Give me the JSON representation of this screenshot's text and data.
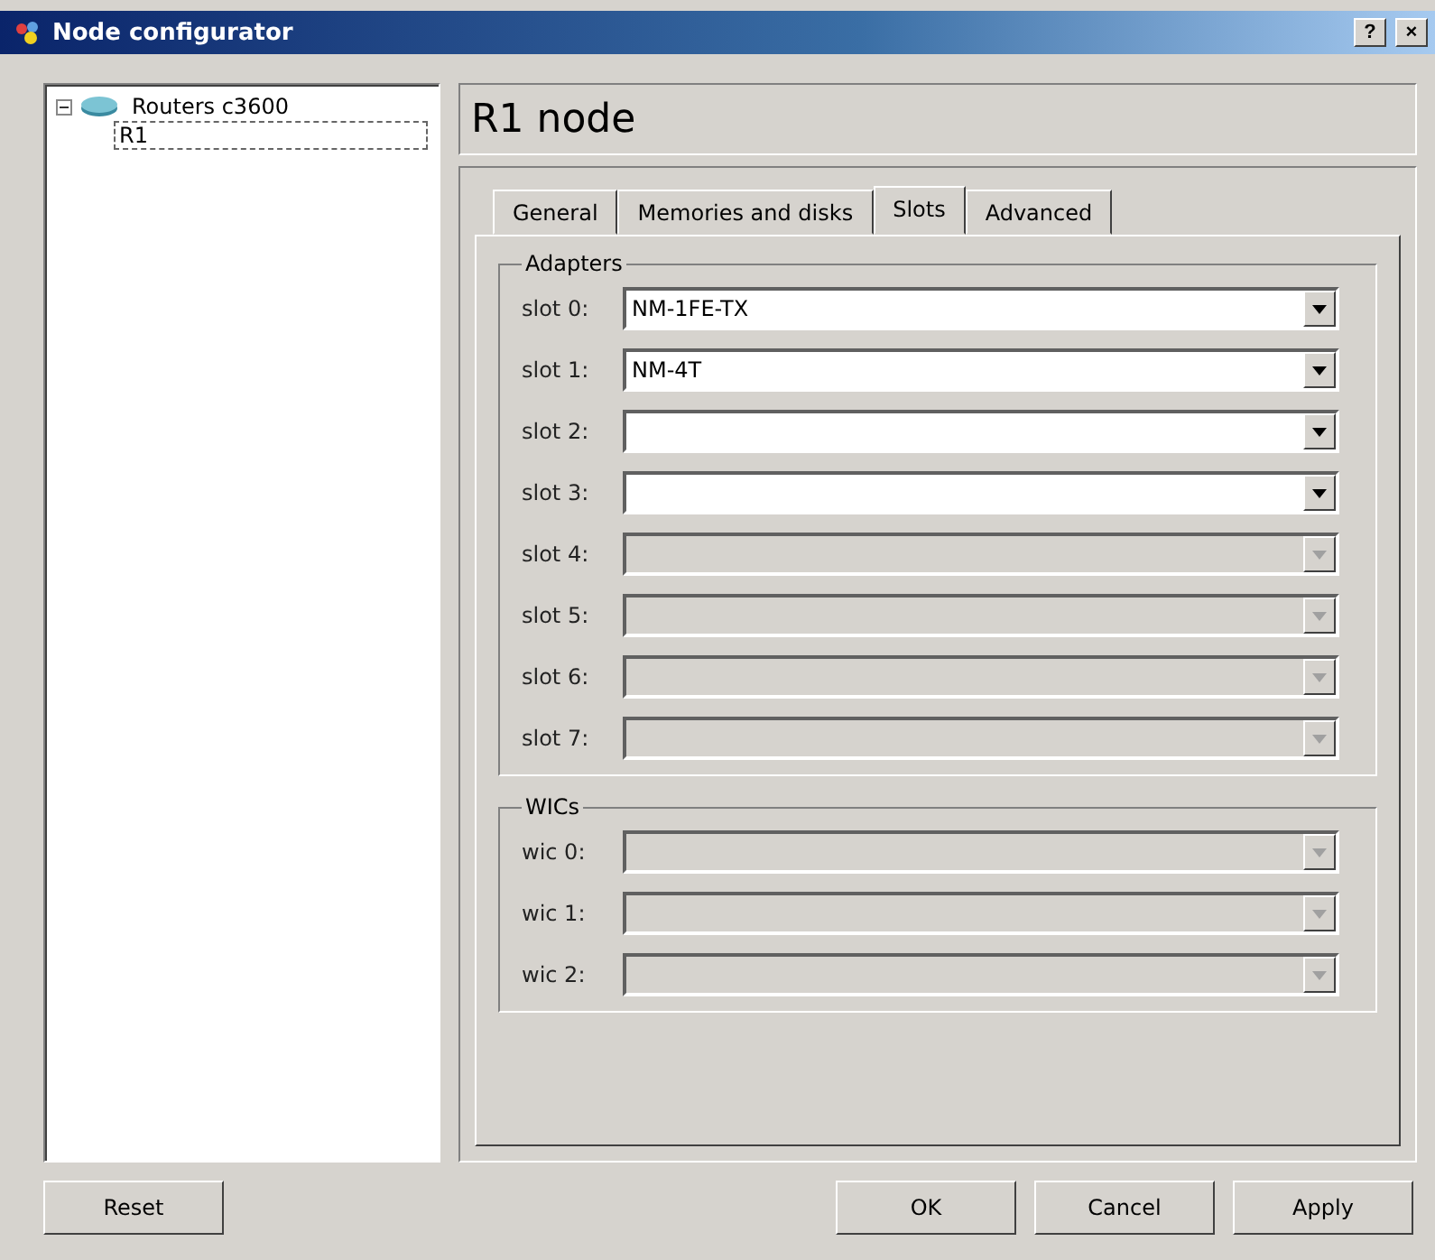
{
  "window": {
    "title": "Node configurator",
    "help": "?",
    "close": "×"
  },
  "tree": [
    {
      "label": "Routers c3600",
      "expanded": true,
      "selected": false,
      "children": [
        {
          "label": "R1",
          "selected": true
        }
      ]
    }
  ],
  "header": "R1 node",
  "tabs": [
    {
      "label": "General",
      "selected": false
    },
    {
      "label": "Memories and disks",
      "selected": false
    },
    {
      "label": "Slots",
      "selected": true
    },
    {
      "label": "Advanced",
      "selected": false
    }
  ],
  "groups": [
    {
      "title": "Adapters",
      "rows": [
        {
          "label": "slot 0:",
          "value": "NM-1FE-TX",
          "disabled": false
        },
        {
          "label": "slot 1:",
          "value": "NM-4T",
          "disabled": false
        },
        {
          "label": "slot 2:",
          "disabled": false
        },
        {
          "label": "slot 3:",
          "disabled": false
        },
        {
          "label": "slot 4:",
          "disabled": true
        },
        {
          "label": "slot 5:",
          "disabled": true
        },
        {
          "label": "slot 6:",
          "disabled": true
        },
        {
          "label": "slot 7:",
          "disabled": true
        }
      ]
    },
    {
      "title": "WICs",
      "rows": [
        {
          "label": "wic 0:",
          "disabled": true
        },
        {
          "label": "wic 1:",
          "disabled": true
        },
        {
          "label": "wic 2:",
          "disabled": true
        }
      ]
    }
  ],
  "buttons": {
    "left": [
      "Reset"
    ],
    "right": [
      "OK",
      "Cancel",
      "Apply"
    ]
  }
}
